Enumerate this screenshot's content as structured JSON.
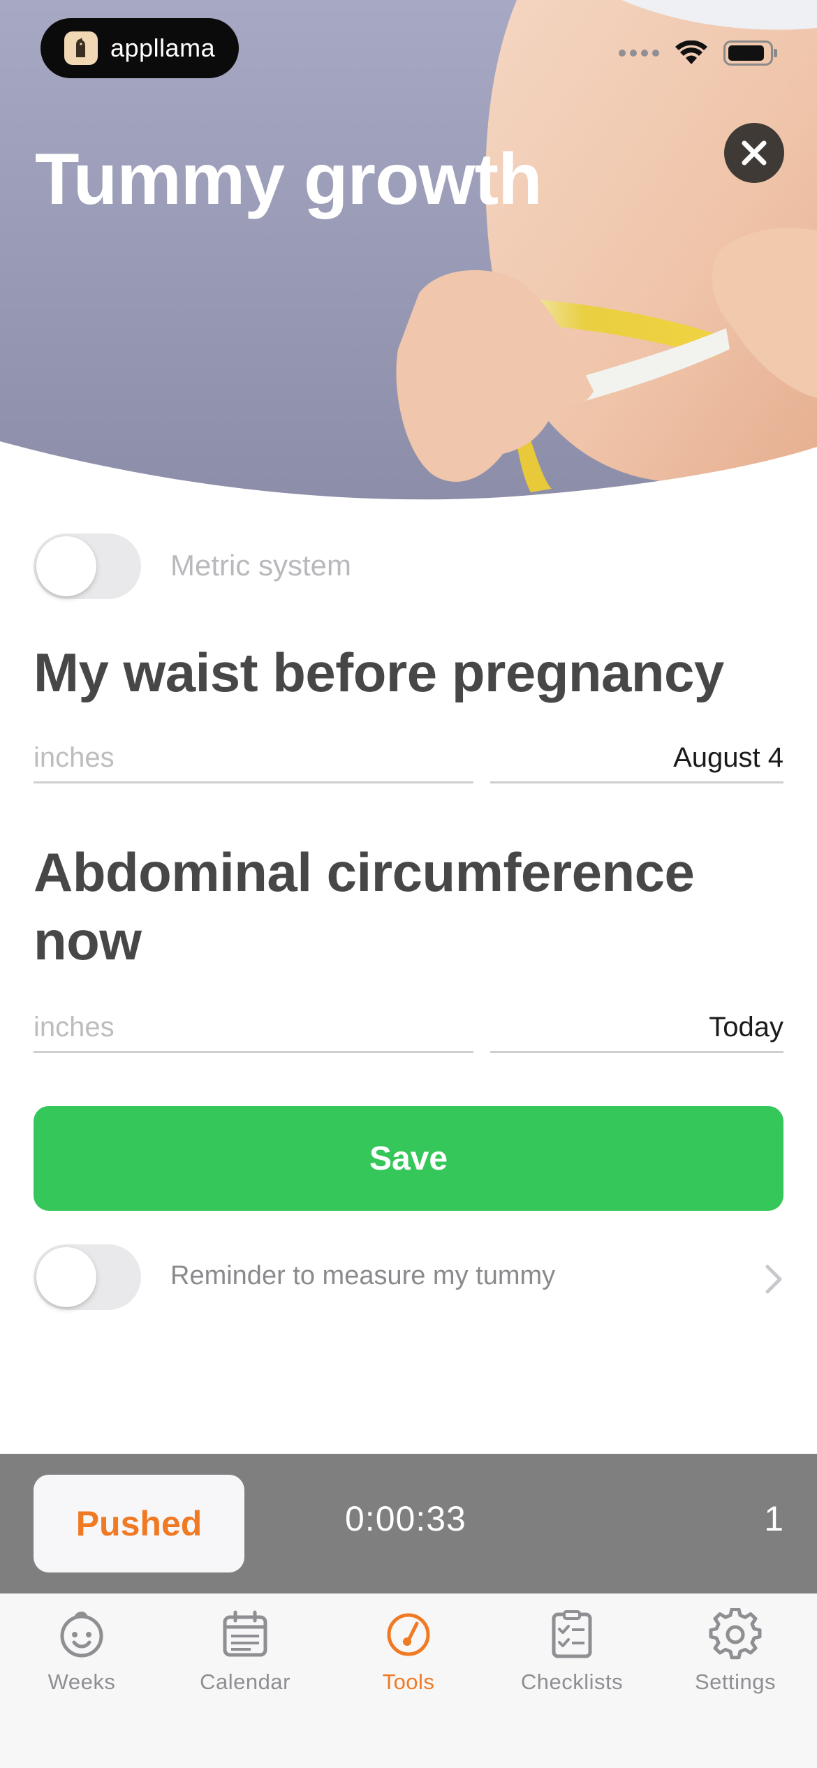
{
  "status_bar": {
    "app_badge": "appllama"
  },
  "hero": {
    "title": "Tummy growth"
  },
  "metric_toggle": {
    "label": "Metric system",
    "on": false
  },
  "waist_before": {
    "title": "My waist before pregnancy",
    "placeholder": "inches",
    "date": "August 4"
  },
  "abdominal_now": {
    "title": "Abdominal circumference now",
    "placeholder": "inches",
    "date": "Today"
  },
  "save_label": "Save",
  "reminder_toggle": {
    "label": "Reminder to measure my tummy",
    "on": false
  },
  "recording_bar": {
    "pushed_label": "Pushed",
    "timer": "0:00:33",
    "count": "1"
  },
  "tabs": [
    {
      "label": "Weeks",
      "icon": "baby-face-icon",
      "active": false
    },
    {
      "label": "Calendar",
      "icon": "calendar-icon",
      "active": false
    },
    {
      "label": "Tools",
      "icon": "gauge-icon",
      "active": true
    },
    {
      "label": "Checklists",
      "icon": "checklist-icon",
      "active": false
    },
    {
      "label": "Settings",
      "icon": "gear-icon",
      "active": false
    }
  ],
  "colors": {
    "accent": "#f07a24",
    "save_green": "#35c75a",
    "title_gray": "#474747",
    "hero_purple": "#9a9dbb"
  }
}
